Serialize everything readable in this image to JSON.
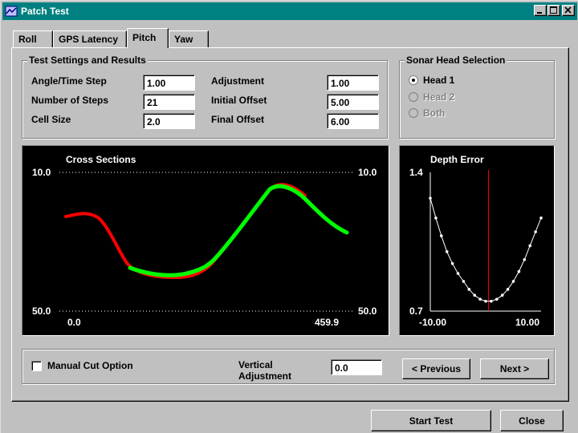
{
  "window": {
    "title": "Patch Test",
    "title_color": "#008080"
  },
  "tabs": [
    {
      "label": "Roll",
      "active": false
    },
    {
      "label": "GPS Latency",
      "active": false
    },
    {
      "label": "Pitch",
      "active": true
    },
    {
      "label": "Yaw",
      "active": false
    }
  ],
  "settings": {
    "legend": "Test Settings and Results",
    "angle_time_step": {
      "label": "Angle/Time Step",
      "value": "1.00"
    },
    "number_of_steps": {
      "label": "Number of Steps",
      "value": "21"
    },
    "cell_size": {
      "label": "Cell Size",
      "value": "2.0"
    },
    "adjustment": {
      "label": "Adjustment",
      "value": "1.00"
    },
    "initial_offset": {
      "label": "Initial Offset",
      "value": "5.00"
    },
    "final_offset": {
      "label": "Final Offset",
      "value": "6.00"
    }
  },
  "sonar": {
    "legend": "Sonar Head Selection",
    "options": [
      {
        "label": "Head 1",
        "selected": true,
        "enabled": true
      },
      {
        "label": "Head 2",
        "selected": false,
        "enabled": false
      },
      {
        "label": "Both",
        "selected": false,
        "enabled": false
      }
    ]
  },
  "cross_sections": {
    "title": "Cross Sections",
    "y_top_left": "10.0",
    "y_top_right": "10.0",
    "y_bottom_left": "50.0",
    "y_bottom_right": "50.0",
    "x_min_label": "0.0",
    "x_max_label": "459.9",
    "red_color": "#ff0000",
    "green_color": "#00ff00"
  },
  "chart_data": {
    "type": "line",
    "title": "Depth Error",
    "x_min_label": "-10.00",
    "x_max_label": "10.00",
    "y_top_label": "1.4",
    "y_bottom_label": "0.7",
    "xlim": [
      -10.0,
      10.0
    ],
    "ylim": [
      0.7,
      1.4
    ],
    "x": [
      -10,
      -9,
      -8,
      -7,
      -6,
      -5,
      -4,
      -3,
      -2,
      -1,
      0,
      1,
      2,
      3,
      4,
      5,
      6,
      7,
      8,
      9,
      10
    ],
    "values": [
      1.27,
      1.17,
      1.08,
      1.0,
      0.94,
      0.89,
      0.85,
      0.81,
      0.78,
      0.76,
      0.75,
      0.75,
      0.76,
      0.78,
      0.81,
      0.85,
      0.9,
      0.96,
      1.03,
      1.1,
      1.17
    ],
    "marker_x": 0.5,
    "line_color": "#ffffff",
    "marker_color": "#ff0000"
  },
  "bottom": {
    "manual_cut_label": "Manual Cut Option",
    "manual_cut_checked": false,
    "vertical_adjustment_label_1": "Vertical",
    "vertical_adjustment_label_2": "Adjustment",
    "vertical_adjustment_value": "0.0",
    "previous_label": "< Previous",
    "next_label": "Next >"
  },
  "footer": {
    "start_test_label": "Start Test",
    "close_label": "Close"
  }
}
